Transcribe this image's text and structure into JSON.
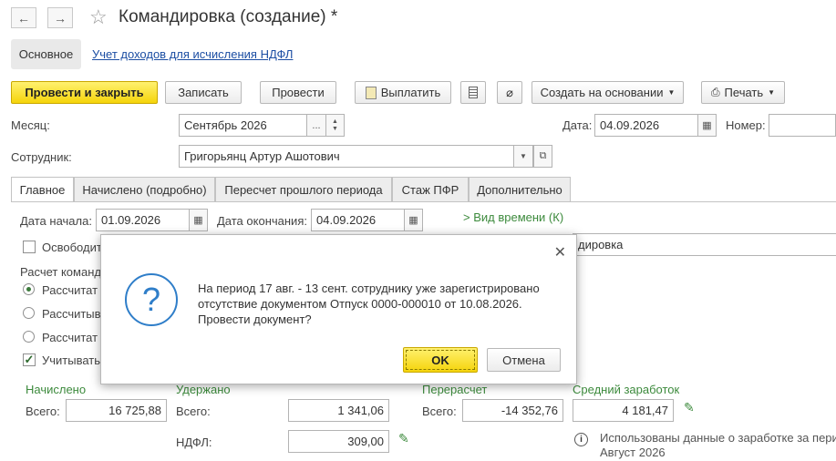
{
  "nav": {
    "back_icon": "←",
    "forward_icon": "→"
  },
  "header": {
    "title": "Командировка (создание) *"
  },
  "sections": {
    "main": "Основное",
    "ndfl_link": "Учет доходов для исчисления НДФЛ"
  },
  "toolbar": {
    "post_close": "Провести и закрыть",
    "save": "Записать",
    "post": "Провести",
    "pay": "Выплатить",
    "create_based": "Создать на основании",
    "print": "Печать"
  },
  "form": {
    "month_label": "Месяц:",
    "month_value": "Сентябрь 2026",
    "date_label": "Дата:",
    "date_value": "04.09.2026",
    "number_label": "Номер:",
    "employee_label": "Сотрудник:",
    "employee_value": "Григорьянц Артур Ашотович"
  },
  "tabs": [
    "Главное",
    "Начислено (подробно)",
    "Пересчет прошлого периода",
    "Стаж ПФР",
    "Дополнительно"
  ],
  "main_tab": {
    "start_label": "Дата начала:",
    "start_value": "01.09.2026",
    "end_label": "Дата окончания:",
    "end_value": "04.09.2026",
    "time_type_link": "Вид времени (К)",
    "release_label": "Освободит",
    "right_field_value": "дировка",
    "calc_label": "Расчет команд",
    "radio1": "Рассчитат",
    "radio2": "Рассчитыв",
    "radio3": "Рассчитат",
    "check_label": "Учитывать"
  },
  "totals": {
    "accrued_title": "Начислено",
    "accrued_total_label": "Всего:",
    "accrued_total": "16 725,88",
    "withheld_title": "Удержано",
    "withheld_total_label": "Всего:",
    "withheld_total": "1 341,06",
    "ndfl_label": "НДФЛ:",
    "ndfl_value": "309,00",
    "recalc_title": "Перерасчет",
    "recalc_total_label": "Всего:",
    "recalc_total": "-14 352,76",
    "avg_title": "Средний заработок",
    "avg_value": "4 181,47",
    "info_text": "Использованы данные о заработке за пери",
    "info_text2": "Август 2026"
  },
  "dialog": {
    "line1": "На период 17 авг. - 13 сент. сотруднику уже зарегистрировано",
    "line2": "отсутствие документом Отпуск 0000-000010 от 10.08.2026.",
    "line3": "Провести документ?",
    "ok": "OK",
    "cancel": "Отмена"
  }
}
